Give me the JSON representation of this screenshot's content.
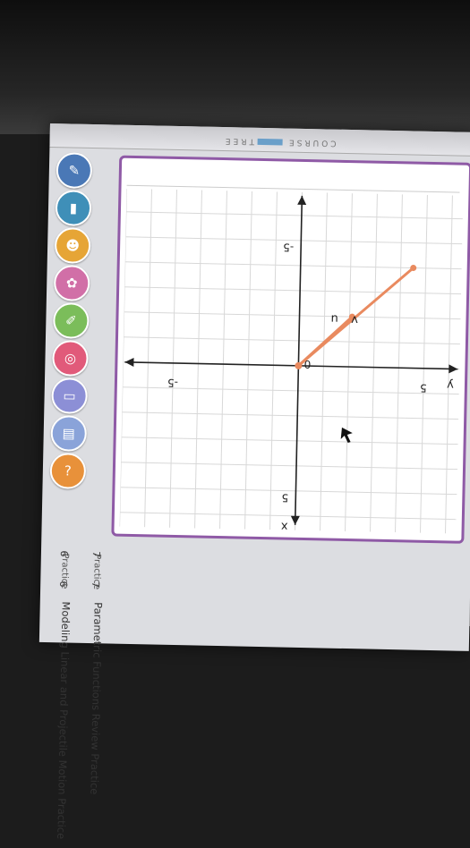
{
  "app": {
    "brand": "COURSE",
    "brand_sub": "TREE"
  },
  "icons": [
    {
      "name": "wrench-icon",
      "color": "#4a78b6",
      "glyph": "✎"
    },
    {
      "name": "book-icon",
      "color": "#3f8fb8",
      "glyph": "▮"
    },
    {
      "name": "person-icon",
      "color": "#e6a536",
      "glyph": "☻"
    },
    {
      "name": "flashcard-icon",
      "color": "#d16fa7",
      "glyph": "✿"
    },
    {
      "name": "pencil-icon",
      "color": "#7bbd5a",
      "glyph": "✐"
    },
    {
      "name": "target-icon",
      "color": "#e15a7a",
      "glyph": "◎"
    },
    {
      "name": "note-icon",
      "color": "#8c8fd6",
      "glyph": "▭"
    },
    {
      "name": "document-icon",
      "color": "#8aa3d9",
      "glyph": "▤"
    },
    {
      "name": "help-icon",
      "color": "#e8913a",
      "glyph": "?"
    }
  ],
  "graph": {
    "x_label": "x",
    "y_label": "y",
    "x_tick_pos": "5",
    "x_tick_neg": "-5",
    "y_tick_pos": "5",
    "y_tick_neg": "-5",
    "origin": "0",
    "vector_u_label": "u",
    "vector_v_label": "v",
    "vector_color": "#e98a5f",
    "vectors": [
      {
        "name": "u",
        "to": [
          -4,
          4.5
        ]
      },
      {
        "name": "v",
        "to": [
          -2,
          2.1
        ]
      }
    ]
  },
  "list": {
    "rows": [
      {
        "num": "6",
        "index": "6",
        "text": "Modeling Linear and Projectile Motion Practice",
        "tag": "Practice"
      },
      {
        "num": "7",
        "index": "7",
        "text": "Parametric Functions Review Practice",
        "tag": "Practice"
      }
    ]
  }
}
